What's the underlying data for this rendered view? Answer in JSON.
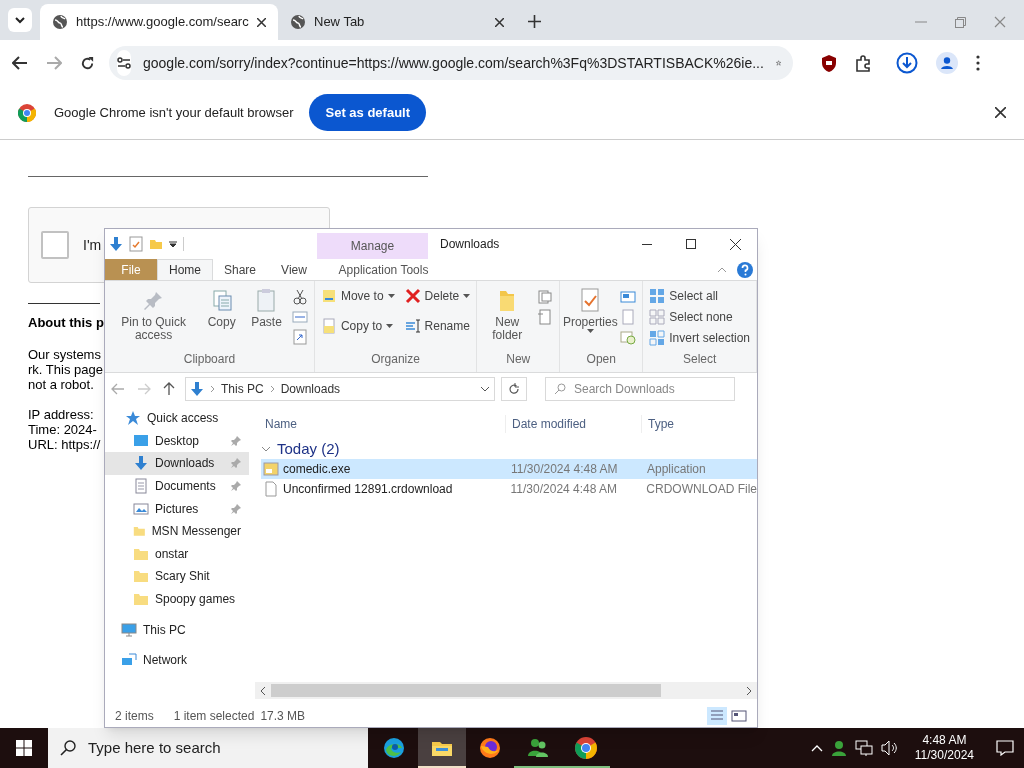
{
  "browser": {
    "tabs": [
      {
        "title": "https://www.google.com/searc",
        "selected": true
      },
      {
        "title": "New Tab",
        "selected": false
      }
    ],
    "address": "google.com/sorry/index?continue=https://www.google.com/search%3Fq%3DSTARTISBACK%26ie...",
    "infobar": {
      "message": "Google Chrome isn't your default browser",
      "button": "Set as default"
    }
  },
  "page": {
    "captcha": {
      "label": "I'm",
      "checked": false
    },
    "heading": "About this p",
    "lines": [
      "Our systems",
      "rk. This page",
      "not a robot."
    ],
    "details": [
      "IP address:",
      "Time: 2024-",
      "URL: https://"
    ]
  },
  "explorer": {
    "title": "Downloads",
    "context_tab": "Manage",
    "tabs": [
      {
        "label": "File",
        "kind": "file",
        "selected": false
      },
      {
        "label": "Home",
        "kind": "tab",
        "selected": true
      },
      {
        "label": "Share",
        "kind": "tab",
        "selected": false
      },
      {
        "label": "View",
        "kind": "tab",
        "selected": false
      },
      {
        "label": "Application Tools",
        "kind": "context",
        "selected": false
      }
    ],
    "ribbon": [
      {
        "label": "Clipboard",
        "items": [
          {
            "label": "Pin to Quick access",
            "kind": "large",
            "dropdown": false
          },
          {
            "label": "Copy",
            "kind": "large",
            "dropdown": false
          },
          {
            "label": "Paste",
            "kind": "large",
            "dropdown": false
          }
        ]
      },
      {
        "label": "Organize",
        "items": [
          {
            "label": "Move to",
            "kind": "small",
            "dropdown": true
          },
          {
            "label": "Copy to",
            "kind": "small",
            "dropdown": true
          },
          {
            "label": "Delete",
            "kind": "small",
            "dropdown": true
          },
          {
            "label": "Rename",
            "kind": "small",
            "dropdown": false
          }
        ]
      },
      {
        "label": "New",
        "items": [
          {
            "label": "New folder",
            "kind": "large",
            "dropdown": false
          }
        ]
      },
      {
        "label": "Open",
        "items": [
          {
            "label": "Properties",
            "kind": "large",
            "dropdown": true
          }
        ]
      },
      {
        "label": "Select",
        "items": [
          {
            "label": "Select all",
            "kind": "small",
            "dropdown": false
          },
          {
            "label": "Select none",
            "kind": "small",
            "dropdown": false
          },
          {
            "label": "Invert selection",
            "kind": "small",
            "dropdown": false
          }
        ]
      }
    ],
    "path": [
      "This PC",
      "Downloads"
    ],
    "search": {
      "placeholder": "Search Downloads"
    },
    "nav": [
      {
        "label": "Quick access",
        "kind": "quick",
        "selected": false,
        "pinned": false
      },
      {
        "label": "Desktop",
        "kind": "desktop",
        "selected": false,
        "pinned": true
      },
      {
        "label": "Downloads",
        "kind": "downloads",
        "selected": true,
        "pinned": true
      },
      {
        "label": "Documents",
        "kind": "documents",
        "selected": false,
        "pinned": true
      },
      {
        "label": "Pictures",
        "kind": "pictures",
        "selected": false,
        "pinned": true
      },
      {
        "label": "MSN Messenger",
        "kind": "folder",
        "selected": false,
        "pinned": false
      },
      {
        "label": "onstar",
        "kind": "folder",
        "selected": false,
        "pinned": false
      },
      {
        "label": "Scary Shit",
        "kind": "folder",
        "selected": false,
        "pinned": false
      },
      {
        "label": "Spoopy games",
        "kind": "folder",
        "selected": false,
        "pinned": false
      },
      {
        "label": "This PC",
        "kind": "pc",
        "selected": false,
        "pinned": false
      },
      {
        "label": "Network",
        "kind": "network",
        "selected": false,
        "pinned": false
      }
    ],
    "columns": [
      "Name",
      "Date modified",
      "Type"
    ],
    "group": "Today (2)",
    "files": [
      {
        "name": "comedic.exe",
        "date": "11/30/2024 4:48 AM",
        "type": "Application",
        "kind": "app",
        "selected": true
      },
      {
        "name": "Unconfirmed 12891.crdownload",
        "date": "11/30/2024 4:48 AM",
        "type": "CRDOWNLOAD File",
        "kind": "file",
        "selected": false
      }
    ],
    "status": {
      "count": "2 items",
      "selection": "1 item selected",
      "size": "17.3 MB"
    }
  },
  "taskbar": {
    "search": {
      "placeholder": "Type here to search"
    },
    "apps": [
      {
        "kind": "edge",
        "active": false,
        "running": false
      },
      {
        "kind": "explorer",
        "active": true,
        "running": true
      },
      {
        "kind": "firefox",
        "active": false,
        "running": false
      },
      {
        "kind": "messenger",
        "active": false,
        "running": true
      },
      {
        "kind": "chrome",
        "active": false,
        "running": true
      }
    ],
    "time": "4:48 AM",
    "date": "11/30/2024"
  }
}
